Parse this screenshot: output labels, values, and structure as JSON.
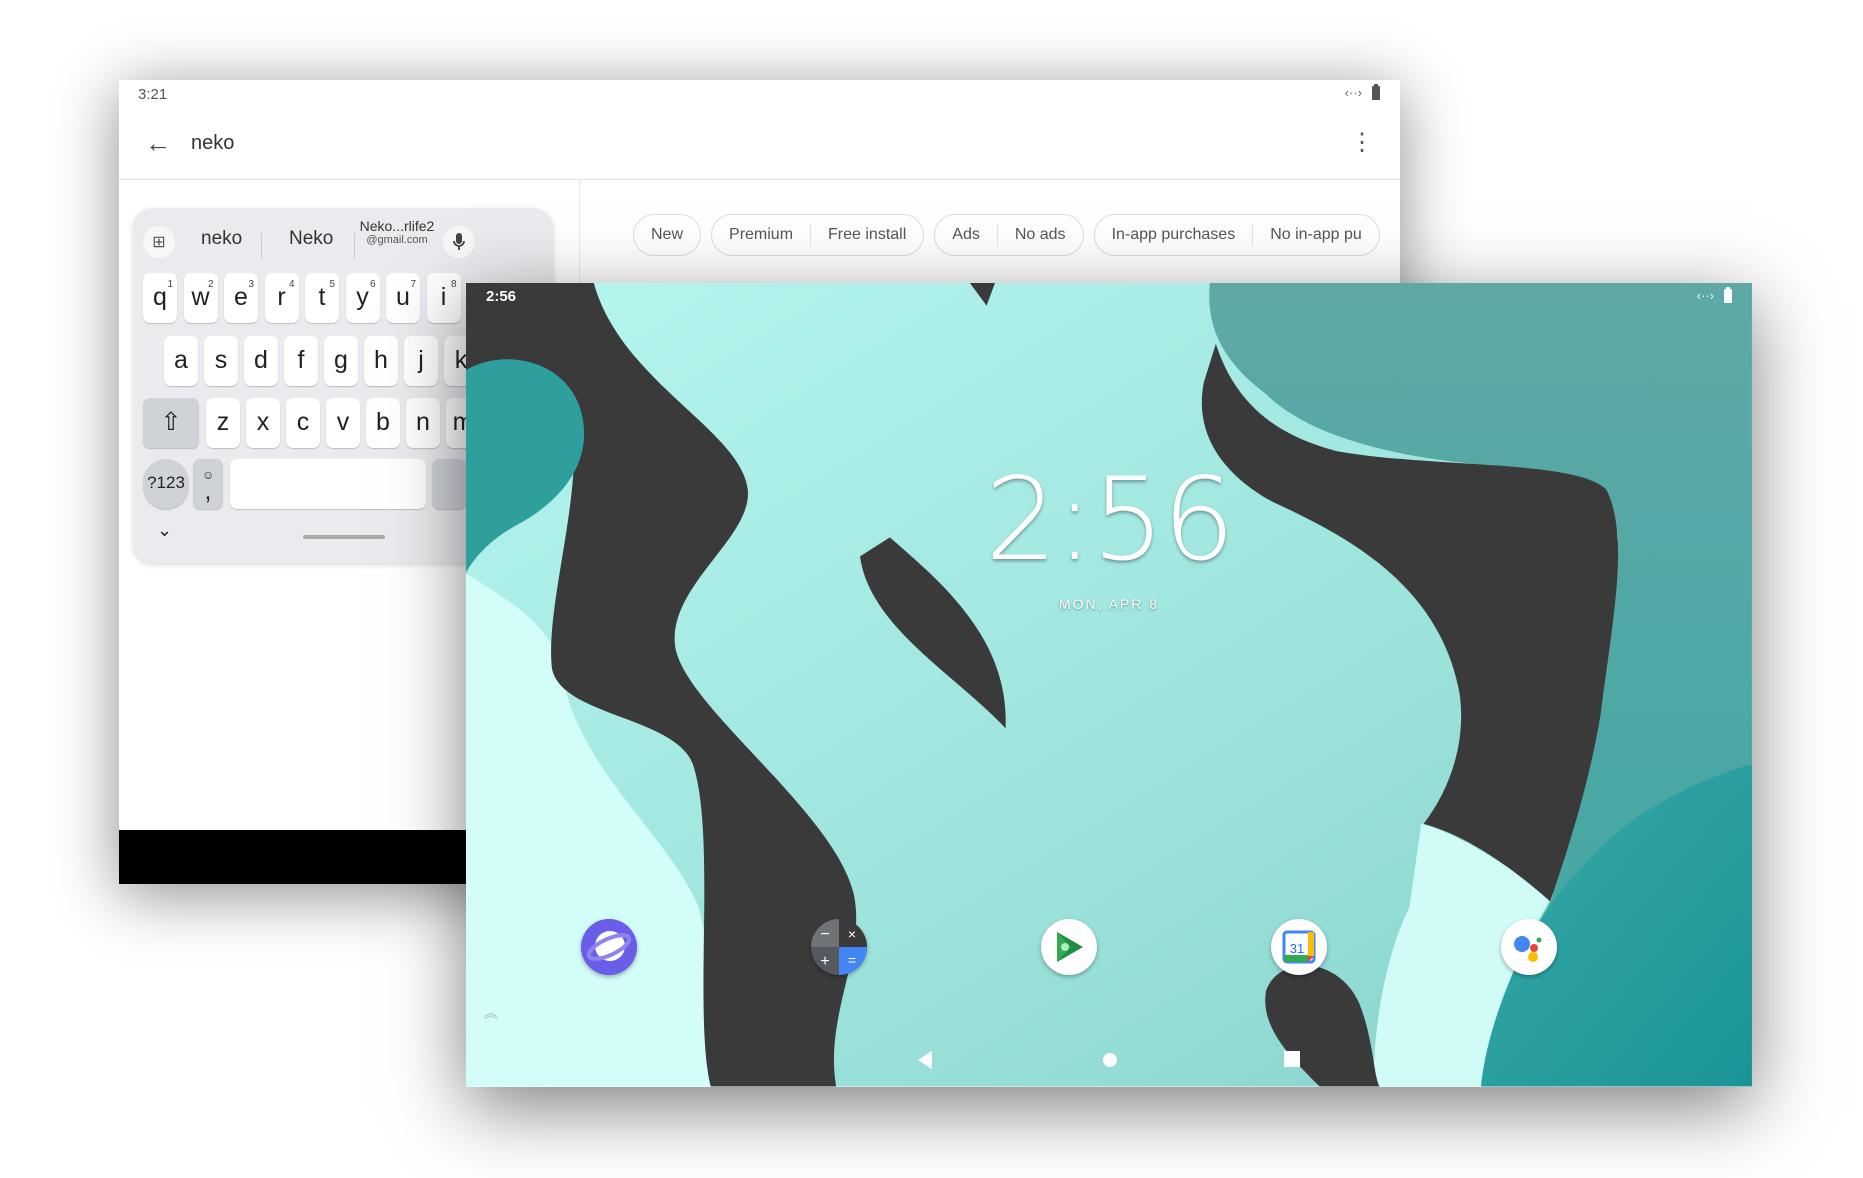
{
  "back_window": {
    "status": {
      "time": "3:21"
    },
    "toolbar": {
      "query": "neko"
    },
    "filters": [
      {
        "options": [
          "New"
        ]
      },
      {
        "options": [
          "Premium",
          "Free install"
        ]
      },
      {
        "options": [
          "Ads",
          "No ads"
        ]
      },
      {
        "options": [
          "In-app purchases",
          "No in-app pu"
        ]
      }
    ],
    "keyboard": {
      "suggestions": [
        "neko",
        "Neko"
      ],
      "email_suggestion": {
        "line1": "Neko...rlife2",
        "line2": "@gmail.com"
      },
      "row1": [
        {
          "k": "q",
          "n": "1"
        },
        {
          "k": "w",
          "n": "2"
        },
        {
          "k": "e",
          "n": "3"
        },
        {
          "k": "r",
          "n": "4"
        },
        {
          "k": "t",
          "n": "5"
        },
        {
          "k": "y",
          "n": "6"
        },
        {
          "k": "u",
          "n": "7"
        },
        {
          "k": "i",
          "n": "8"
        }
      ],
      "row2": [
        "a",
        "s",
        "d",
        "f",
        "g",
        "h",
        "j",
        "k"
      ],
      "row3": [
        "z",
        "x",
        "c",
        "v",
        "b",
        "n",
        "m"
      ],
      "symbols_label": "?123",
      "comma_label": ","
    }
  },
  "front_window": {
    "status": {
      "time": "2:56"
    },
    "clock": "2:56",
    "date": "MON, APR 8",
    "dock": [
      "samsung-internet-icon",
      "calculator-icon",
      "play-games-icon",
      "google-calendar-icon",
      "google-assistant-icon"
    ],
    "calendar_day": "31"
  }
}
